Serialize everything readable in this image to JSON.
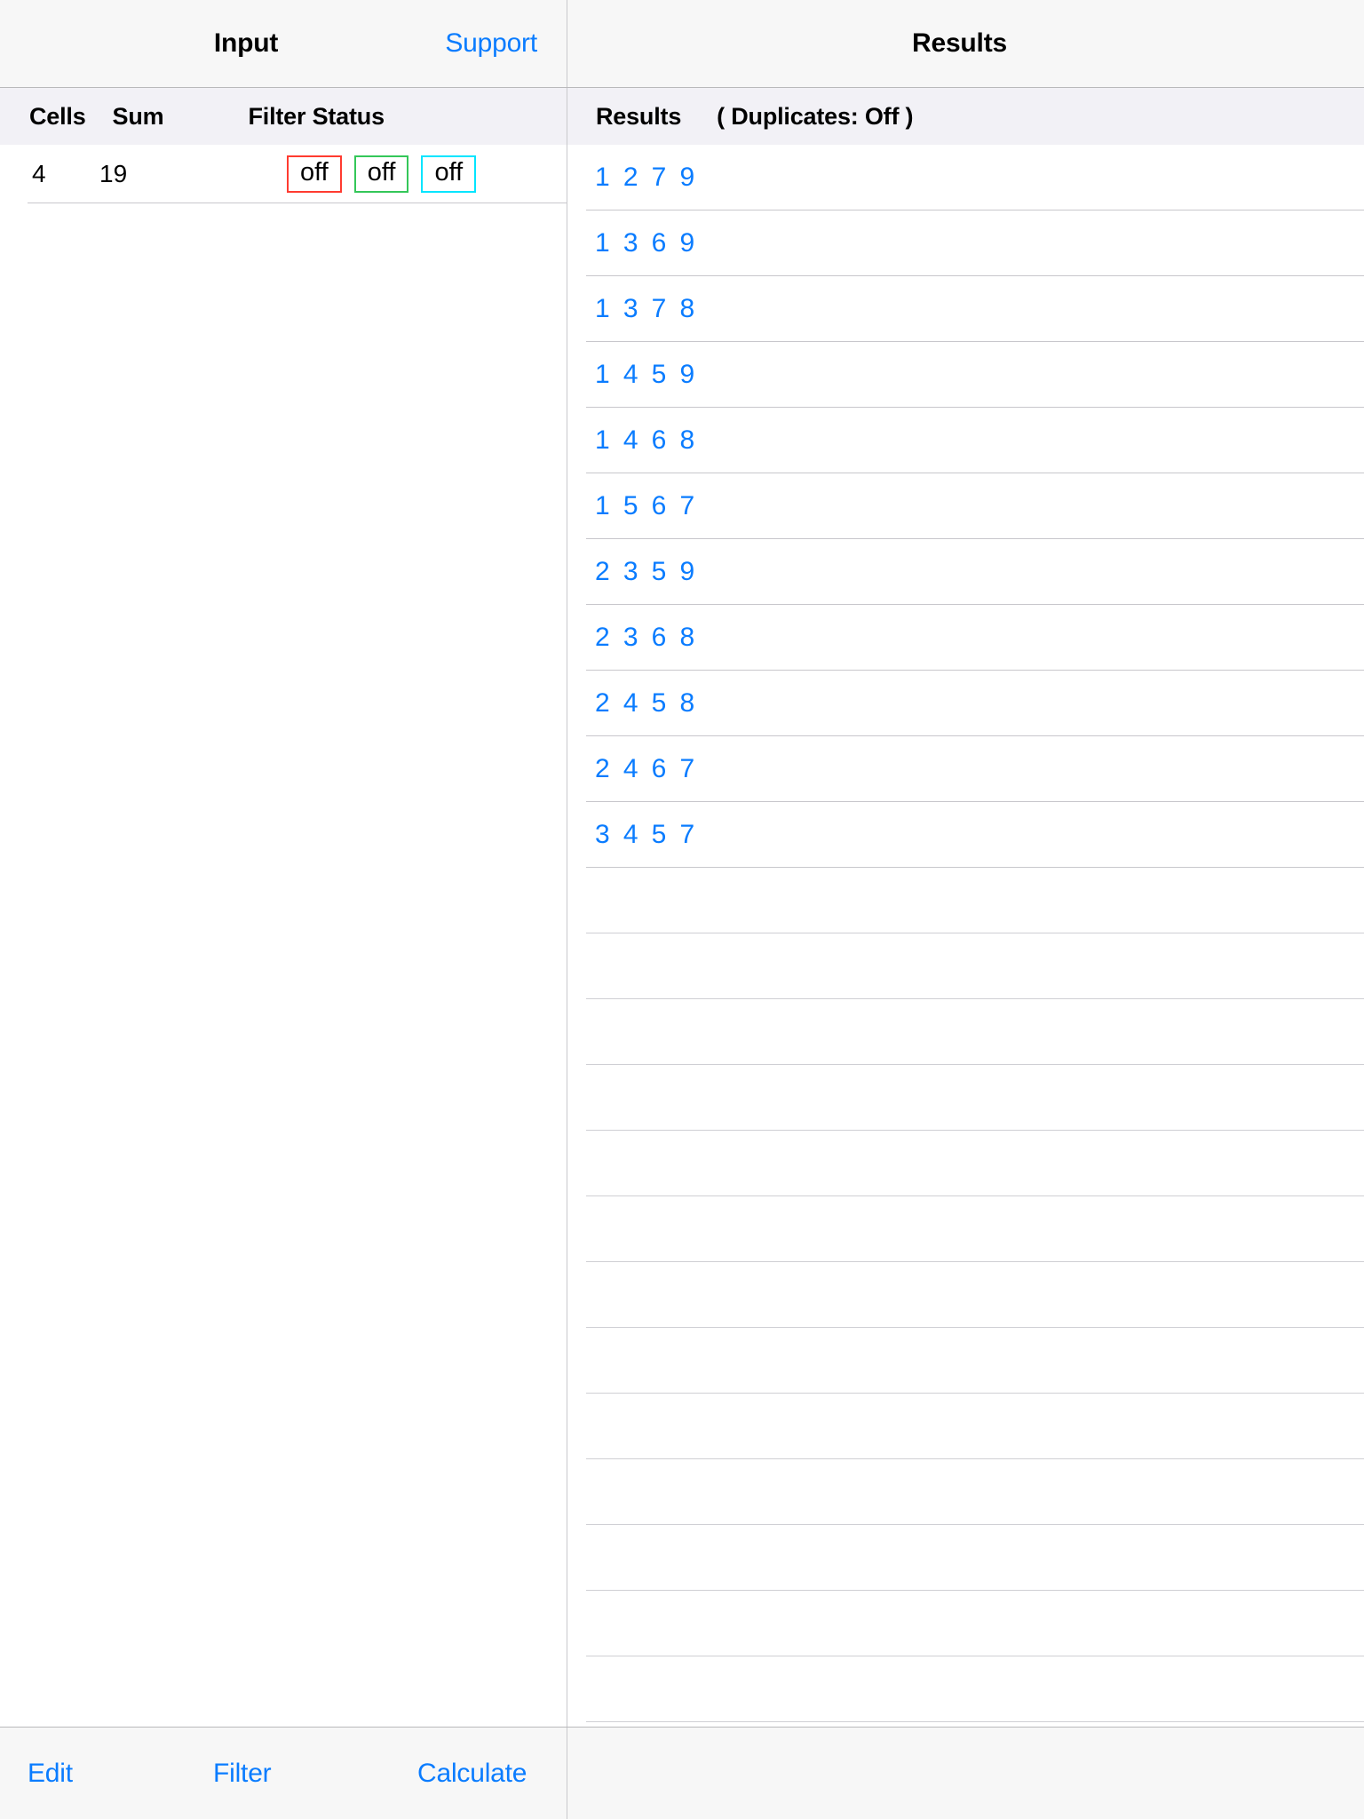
{
  "navbar": {
    "left_title": "Input",
    "support_label": "Support",
    "right_title": "Results"
  },
  "input_panel": {
    "headers": {
      "cells": "Cells",
      "sum": "Sum",
      "filter_status": "Filter Status"
    },
    "row": {
      "cells": "4",
      "sum": "19",
      "filters": [
        {
          "label": "off",
          "color": "#ff3b30"
        },
        {
          "label": "off",
          "color": "#34c759"
        },
        {
          "label": "off",
          "color": "#00e5ff"
        }
      ]
    }
  },
  "results_panel": {
    "header": {
      "title": "Results",
      "duplicates": "( Duplicates:  Off )"
    },
    "items": [
      "1 2 7 9",
      "1 3 6 9",
      "1 3 7 8",
      "1 4 5 9",
      "1 4 6 8",
      "1 5 6 7",
      "2 3 5 9",
      "2 3 6 8",
      "2 4 5 8",
      "2 4 6 7",
      "3 4 5 7"
    ],
    "blank_row_count": 13
  },
  "toolbar": {
    "edit_label": "Edit",
    "filter_label": "Filter",
    "calculate_label": "Calculate"
  },
  "colors": {
    "accent": "#0a7cff",
    "header_bg": "#f2f1f6",
    "bar_bg": "#f7f7f7",
    "separator": "#c8c7cc"
  }
}
